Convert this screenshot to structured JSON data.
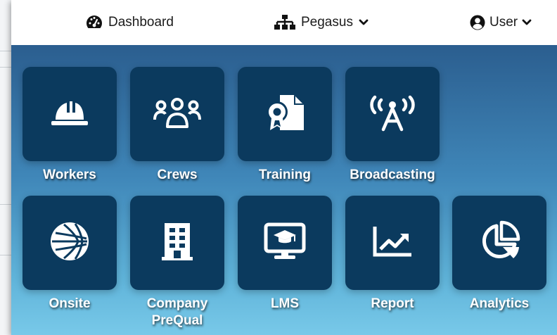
{
  "topbar": {
    "dashboard_label": "Dashboard",
    "org_label": "Pegasus",
    "user_label": "User"
  },
  "tiles": [
    {
      "label": "Workers",
      "icon": "hard-hat-icon"
    },
    {
      "label": "Crews",
      "icon": "users-icon"
    },
    {
      "label": "Training",
      "icon": "certificate-document-icon"
    },
    {
      "label": "Broadcasting",
      "icon": "broadcast-tower-icon"
    },
    {
      "label": "Onsite",
      "icon": "globe-icon"
    },
    {
      "label": "Company",
      "label2": "PreQual",
      "icon": "building-icon"
    },
    {
      "label": "LMS",
      "icon": "graduation-monitor-icon"
    },
    {
      "label": "Report",
      "icon": "line-chart-icon"
    },
    {
      "label": "Analytics",
      "icon": "pie-chart-icon"
    }
  ],
  "colors": {
    "tile": "#0b3a5e",
    "gradient_top": "#2b5e8f",
    "gradient_bottom": "#78c9e9"
  }
}
